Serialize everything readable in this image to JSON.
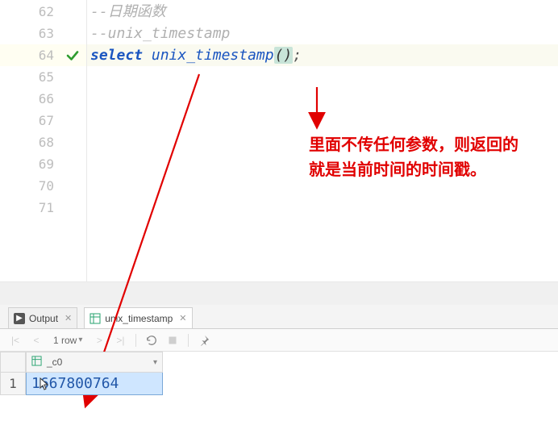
{
  "editor": {
    "lines": [
      {
        "num": 62,
        "kind": "comment",
        "text": "--日期函数"
      },
      {
        "num": 63,
        "kind": "comment",
        "text": "--unix_timestamp"
      },
      {
        "num": 64,
        "kind": "code",
        "active": true,
        "check": true,
        "frags": {
          "kw": "select",
          "sp": " ",
          "fn": "unix_timestamp",
          "paren": "()",
          "semi": ";"
        }
      },
      {
        "num": 65,
        "kind": "blank"
      },
      {
        "num": 66,
        "kind": "blank"
      },
      {
        "num": 67,
        "kind": "blank"
      },
      {
        "num": 68,
        "kind": "blank"
      },
      {
        "num": 69,
        "kind": "blank"
      },
      {
        "num": 70,
        "kind": "blank"
      },
      {
        "num": 71,
        "kind": "blank"
      }
    ]
  },
  "callout": {
    "line1": "里面不传任何参数，则返回的",
    "line2": "就是当前时间的时间戳。"
  },
  "tabs": {
    "output": "Output",
    "result": "unix_timestamp"
  },
  "toolbar": {
    "rowcount": "1 row"
  },
  "grid": {
    "col0_label": "_c0",
    "row1_num": "1",
    "row1_val": "1667800764"
  }
}
